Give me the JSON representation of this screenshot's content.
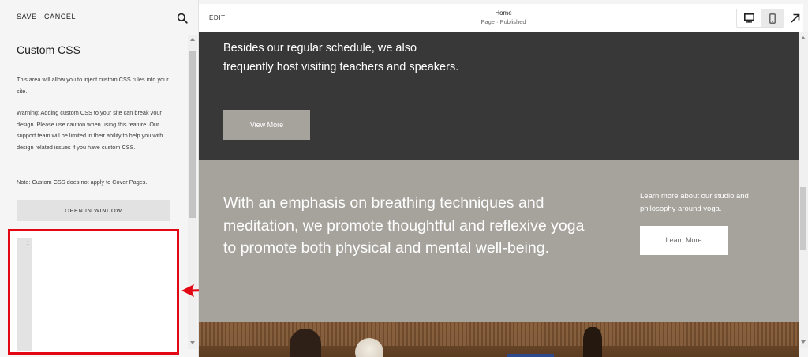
{
  "left_panel": {
    "save_label": "SAVE",
    "cancel_label": "CANCEL",
    "search_icon": "search-icon",
    "title": "Custom CSS",
    "paragraph1": "This area will allow you to inject custom CSS rules into your site.",
    "paragraph2": "Warning: Adding custom CSS to your site can break your design. Please use caution when using this feature. Our support team will be limited in their ability to help you with design related issues if you have custom CSS.",
    "paragraph3": "Note: Custom CSS does not apply to Cover Pages.",
    "open_window_label": "OPEN IN WINDOW",
    "editor": {
      "line_number": "1",
      "content": ""
    }
  },
  "preview": {
    "edit_label": "EDIT",
    "page_title": "Home",
    "page_status": "Page · Published",
    "device_icons": [
      "desktop-icon",
      "mobile-icon"
    ],
    "expand_icon": "arrow-up-right-icon"
  },
  "page_content": {
    "schedule_text": "Besides our regular schedule, we also frequently host visiting teachers and speakers.",
    "view_more_label": "View More",
    "emphasis_heading": "With an emphasis on breathing techniques and meditation, we promote thoughtful and reflexive yoga to promote both physical and mental well-being.",
    "learn_text": "Learn more about our studio and philosophy around yoga.",
    "learn_more_label": "Learn More"
  },
  "colors": {
    "highlight": "#e30613",
    "dark_section": "#383839",
    "gray_section": "#a5a39c",
    "accent_tab": "#2f4a8c"
  }
}
